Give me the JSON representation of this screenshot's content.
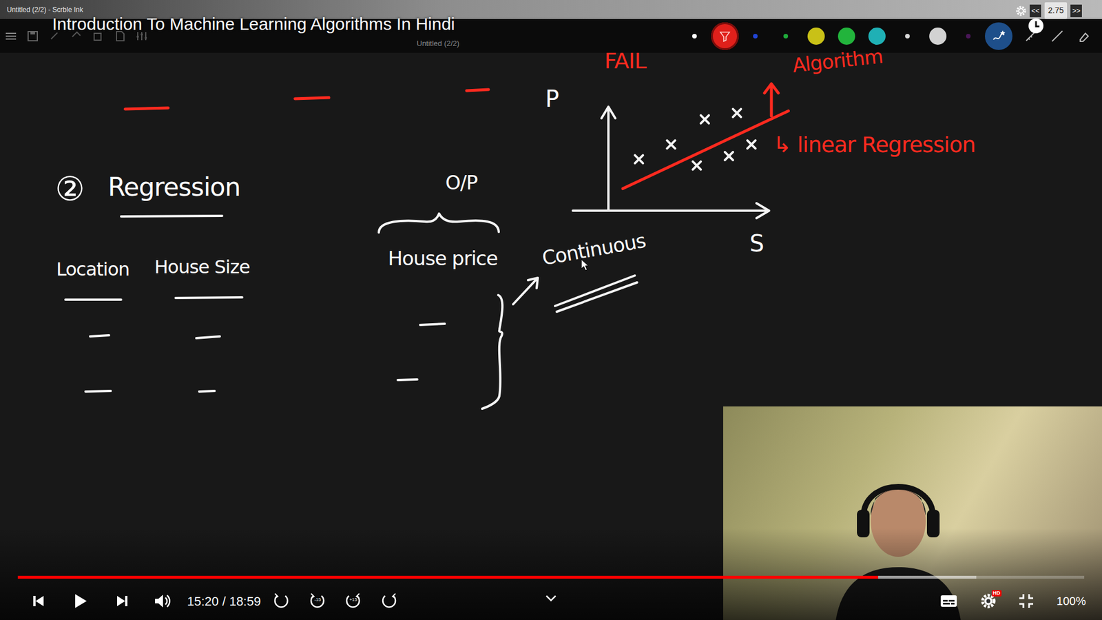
{
  "window": {
    "title": "Untitled (2/2) - Scrble Ink"
  },
  "video": {
    "title": "Introduction To Machine Learning Algorithms In Hindi"
  },
  "toolbar": {
    "doc_title": "Untitled (2/2)",
    "colors": [
      {
        "color": "#ffffff",
        "kind": "dot",
        "selected": false
      },
      {
        "color": "#e0201b",
        "kind": "swatch",
        "selected": true
      },
      {
        "color": "#2145d6",
        "kind": "dot",
        "selected": false
      },
      {
        "color": "#1faa3a",
        "kind": "dot",
        "selected": false
      },
      {
        "color": "#c9c117",
        "kind": "swatch",
        "selected": false
      },
      {
        "color": "#22b43c",
        "kind": "swatch",
        "selected": false
      },
      {
        "color": "#1fb0b5",
        "kind": "swatch",
        "selected": false
      },
      {
        "color": "#d8d8d8",
        "kind": "dot",
        "selected": false
      },
      {
        "color": "#d2d2d2",
        "kind": "swatch",
        "selected": false
      },
      {
        "color": "#4a1758",
        "kind": "dot",
        "selected": false
      },
      {
        "color": "#1e4f8a",
        "kind": "brush",
        "selected": false
      }
    ]
  },
  "speed": {
    "value": "2.75",
    "slower": "<<",
    "faster": ">>"
  },
  "canvas": {
    "notes": [
      {
        "text": "FAIL",
        "color": "#ff2a1f"
      },
      {
        "text": "Algorithm",
        "color": "#ff2a1f"
      },
      {
        "text": "↳ linear Regression",
        "color": "#ff2a1f"
      },
      {
        "text": "P",
        "color": "#ffffff"
      },
      {
        "text": "S",
        "color": "#ffffff"
      },
      {
        "text": "②",
        "color": "#ffffff"
      },
      {
        "text": "Regression",
        "color": "#ffffff"
      },
      {
        "text": "Location",
        "color": "#ffffff"
      },
      {
        "text": "House Size",
        "color": "#ffffff"
      },
      {
        "text": "O/P",
        "color": "#ffffff"
      },
      {
        "text": "House price",
        "color": "#ffffff"
      },
      {
        "text": "Continuous",
        "color": "#ffffff"
      }
    ]
  },
  "chart": {
    "points": [
      [
        1.9,
        4.9
      ],
      [
        3.9,
        6.3
      ],
      [
        6.0,
        8.7
      ],
      [
        8.0,
        9.3
      ],
      [
        5.5,
        4.3
      ],
      [
        7.5,
        5.2
      ],
      [
        8.9,
        6.3
      ]
    ],
    "fit": [
      [
        0.9,
        2.1
      ],
      [
        11.2,
        9.5
      ]
    ]
  },
  "player": {
    "time": "15:20 / 18:59",
    "played": 0.807,
    "buffered": 0.899,
    "skip_back": "-15",
    "skip_forward": "+15",
    "hd_badge": "HD",
    "zoom": "100%"
  }
}
